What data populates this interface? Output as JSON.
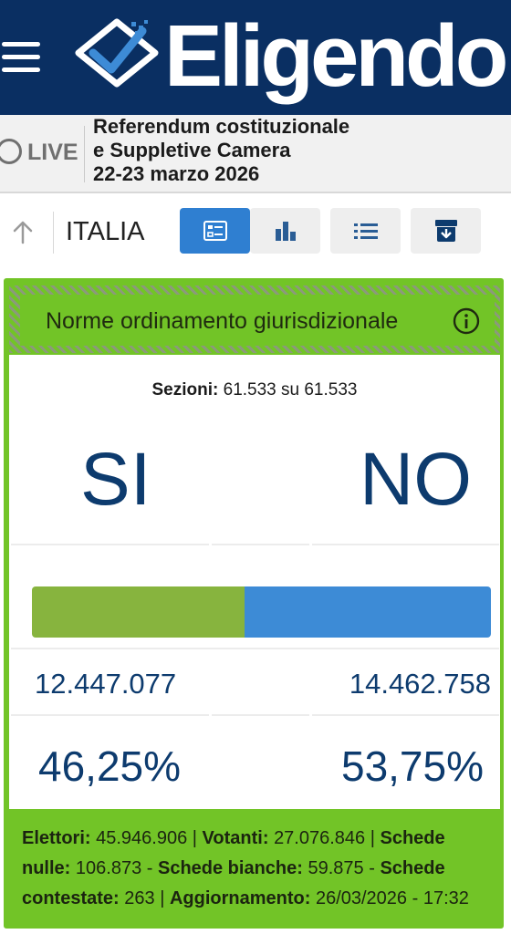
{
  "header": {
    "brand": "Eligendo",
    "menu_icon": "hamburger-icon",
    "logo_icon": "ballot-check-icon",
    "background": "#0a2f62"
  },
  "live": {
    "label": "LIVE",
    "icon": "live-circle-icon",
    "event_lines": [
      "Referendum costituzionale",
      "e Suppletive Camera",
      "22-23 marzo 2026"
    ]
  },
  "toolbar": {
    "scope": "ITALIA",
    "up_icon": "arrow-up-icon",
    "buttons": [
      {
        "icon": "summary-card-icon",
        "active": true
      },
      {
        "icon": "bar-chart-icon",
        "active": false
      },
      {
        "icon": "list-icon",
        "active": false
      },
      {
        "icon": "archive-download-icon",
        "active": false
      }
    ],
    "accent": "#2f7fd1"
  },
  "card": {
    "title": "Norme ordinamento giurisdizionale",
    "info_icon": "info-icon",
    "sezioni_label": "Sezioni:",
    "sezioni_value": "61.533 su 61.533",
    "options": [
      {
        "label": "SI",
        "votes": "12.447.077",
        "percent": "46,25%",
        "share": 0.4625,
        "color": "#87b43e"
      },
      {
        "label": "NO",
        "votes": "14.462.758",
        "percent": "53,75%",
        "share": 0.5375,
        "color": "#3d8bd6"
      }
    ],
    "accent": "#72c427",
    "footer": {
      "elettori_label": "Elettori:",
      "elettori_value": "45.946.906",
      "votanti_label": "Votanti:",
      "votanti_value": "27.076.846",
      "nulle_label": "Schede nulle:",
      "nulle_value": "106.873",
      "bianche_label": "Schede bianche:",
      "bianche_value": "59.875",
      "contestate_label": "Schede contestate:",
      "contestate_value": "263",
      "aggiornamento_label": "Aggiornamento:",
      "aggiornamento_value": "26/03/2026 - 17:32"
    }
  }
}
